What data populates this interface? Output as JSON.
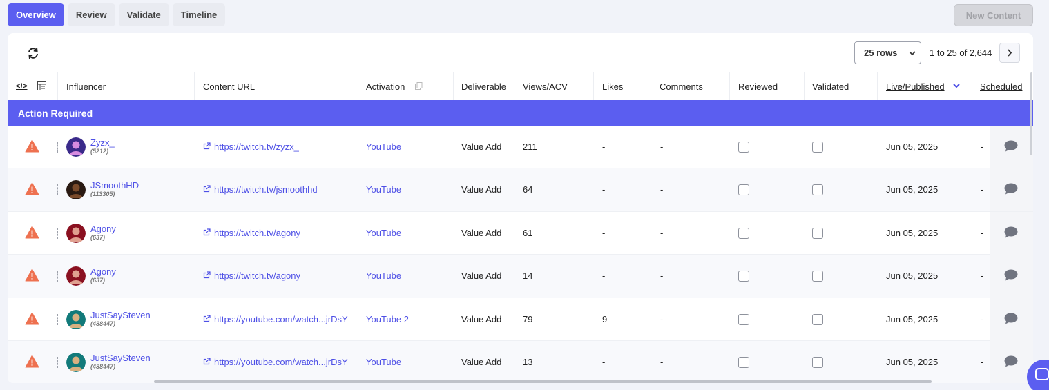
{
  "tabs": [
    {
      "label": "Overview",
      "active": true
    },
    {
      "label": "Review"
    },
    {
      "label": "Validate"
    },
    {
      "label": "Timeline"
    }
  ],
  "new_content_label": "New Content",
  "toolbar": {
    "rows_select": "25 rows",
    "range": "1 to 25 of 2,644"
  },
  "columns": {
    "code": "<!>",
    "influencer": "Influencer",
    "content_url": "Content URL",
    "activation": "Activation",
    "deliverable": "Deliverable",
    "views": "Views/ACV",
    "likes": "Likes",
    "comments": "Comments",
    "reviewed": "Reviewed",
    "validated": "Validated",
    "live": "Live/Published",
    "scheduled": "Scheduled"
  },
  "section_label": "Action Required",
  "rows": [
    {
      "name": "Zyzx_",
      "count": "(5212)",
      "url": "https://twitch.tv/zyzx_",
      "activation": "YouTube",
      "deliverable": "Value Add",
      "views": "211",
      "likes": "-",
      "comments": "-",
      "live": "Jun 05, 2025",
      "scheduled": "-"
    },
    {
      "name": "JSmoothHD",
      "count": "(113305)",
      "url": "https://twitch.tv/jsmoothhd",
      "activation": "YouTube",
      "deliverable": "Value Add",
      "views": "64",
      "likes": "-",
      "comments": "-",
      "live": "Jun 05, 2025",
      "scheduled": "-"
    },
    {
      "name": "Agony",
      "count": "(637)",
      "url": "https://twitch.tv/agony",
      "activation": "YouTube",
      "deliverable": "Value Add",
      "views": "61",
      "likes": "-",
      "comments": "-",
      "live": "Jun 05, 2025",
      "scheduled": "-"
    },
    {
      "name": "Agony",
      "count": "(637)",
      "url": "https://twitch.tv/agony",
      "activation": "YouTube",
      "deliverable": "Value Add",
      "views": "14",
      "likes": "-",
      "comments": "-",
      "live": "Jun 05, 2025",
      "scheduled": "-"
    },
    {
      "name": "JustSaySteven",
      "count": "(488447)",
      "url": "https://youtube.com/watch...jrDsY",
      "activation": "YouTube 2",
      "deliverable": "Value Add",
      "views": "79",
      "likes": "9",
      "comments": "-",
      "live": "Jun 05, 2025",
      "scheduled": "-"
    },
    {
      "name": "JustSaySteven",
      "count": "(488447)",
      "url": "https://youtube.com/watch...jrDsY",
      "activation": "YouTube",
      "deliverable": "Value Add",
      "views": "13",
      "likes": "-",
      "comments": "-",
      "live": "Jun 05, 2025",
      "scheduled": "-"
    }
  ],
  "colors": {
    "accent": "#5b5ef0",
    "link": "#4e50e6",
    "warning": "#ee7150",
    "chat_icon": "#707480"
  },
  "icons": {
    "refresh": "refresh-icon",
    "warning": "warning-triangle-icon",
    "external": "external-link-icon",
    "chat": "comment-icon",
    "next": "chevron-right-icon",
    "sort": "chevron-down-icon"
  }
}
